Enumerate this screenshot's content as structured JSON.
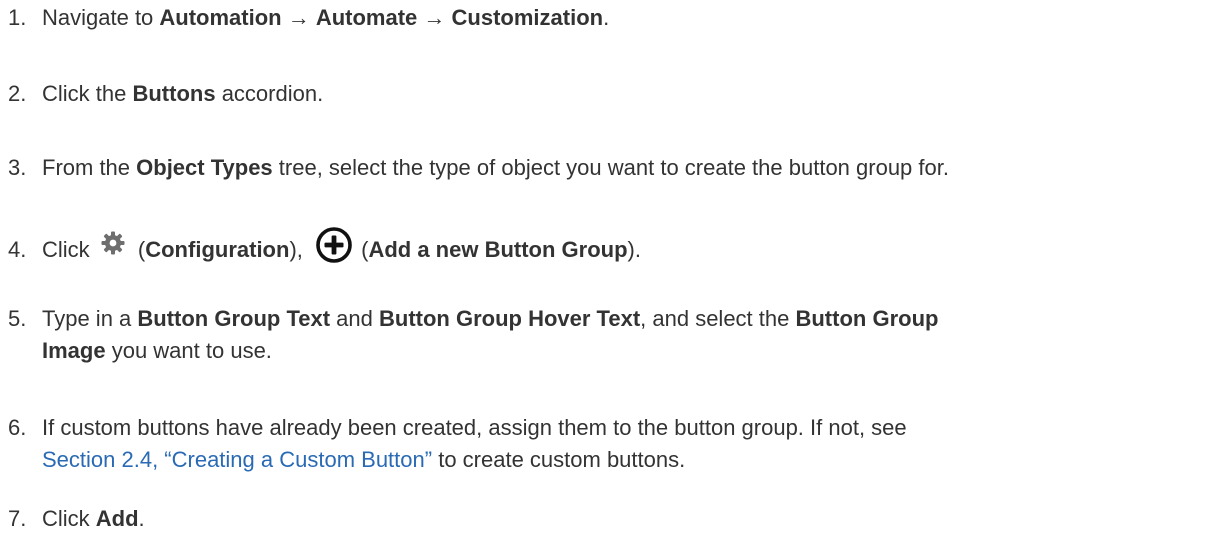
{
  "steps": [
    {
      "number": "1.",
      "t1": "Navigate to ",
      "b1": "Automation",
      "t2": " → ",
      "b2": "Automate",
      "t3": " → ",
      "b3": "Customization",
      "t4": "."
    },
    {
      "number": "2.",
      "t1": "Click the ",
      "b1": "Buttons",
      "t2": " accordion."
    },
    {
      "number": "3.",
      "t1": "From the ",
      "b1": "Object Types",
      "t2": " tree, select the type of object you want to create the button group for."
    },
    {
      "number": "4.",
      "t1": "Click ",
      "icon1": "gear-icon",
      "t2": " (",
      "b1": "Configuration",
      "t3": "), ",
      "icon2": "plus-circle-icon",
      "t4": " (",
      "b2": "Add a new Button Group",
      "t5": ")."
    },
    {
      "number": "5.",
      "t1": "Type in a ",
      "b1": "Button Group Text",
      "t2": " and ",
      "b2": "Button Group Hover Text",
      "t3": ", and select the ",
      "b3": "Button Group",
      "b4": "Image",
      "t4": " you want to use."
    },
    {
      "number": "6.",
      "t1": "If custom buttons have already been created, assign them to the button group. If not, see",
      "link": "Section 2.4, “Creating a Custom Button”",
      "t2": " to create custom buttons."
    },
    {
      "number": "7.",
      "t1": "Click ",
      "b1": "Add",
      "t2": "."
    }
  ],
  "colors": {
    "text": "#333333",
    "link": "#2a6ab5",
    "background": "#ffffff"
  }
}
